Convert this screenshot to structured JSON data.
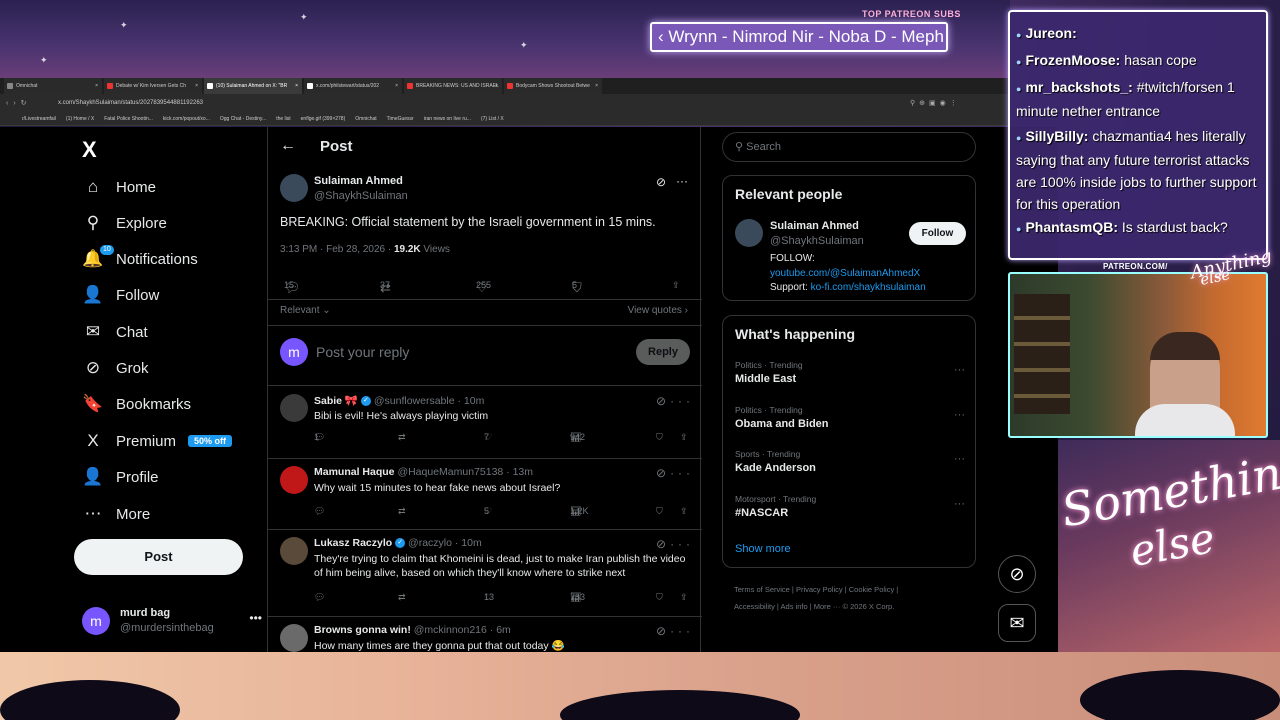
{
  "stream": {
    "ticker_heading": "TOP PATREON SUBS",
    "ticker_text": "‹ Wrynn - Nimrod Nir - Noba D - Meph",
    "patreon_url": "PATREON.COM/",
    "logo_text_1": "Something",
    "logo_text_2": "else",
    "small_logo_1": "Anything",
    "small_logo_2": "else",
    "chat": [
      {
        "user": "Jureon:",
        "text": ""
      },
      {
        "user": "FrozenMoose:",
        "text": "hasan cope"
      },
      {
        "user": "mr_backshots_:",
        "text": "#twitch/forsen 1 minute nether entrance"
      },
      {
        "user": "SillyBilly:",
        "text": "chazmantia4 hes literally saying that any future terrorist attacks are 100% inside jobs to further support for this operation"
      },
      {
        "user": "PhantasmQB:",
        "text": "Is stardust back?"
      }
    ]
  },
  "browser": {
    "tabs": [
      {
        "label": "Omnichat",
        "active": false,
        "color": "#888"
      },
      {
        "label": "Debate w/ Kim Iversen Gets Ch",
        "active": false,
        "color": "#e33"
      },
      {
        "label": "(10) Sulaiman Ahmed on X: \"BR",
        "active": true,
        "color": "#fff"
      },
      {
        "label": "x.com/philstewart/status/202",
        "active": false,
        "color": "#fff"
      },
      {
        "label": "BREAKING NEWS: US AND ISRAEL",
        "active": false,
        "color": "#e33"
      },
      {
        "label": "Bodycam Shows Shootout Betwe",
        "active": false,
        "color": "#e33"
      }
    ],
    "url": "x.com/ShaykhSulaiman/status/2027839544881192263",
    "bookmarks": [
      "r/Livestreamfail",
      "(1) Home / X",
      "Fatal Police Shootin...",
      "kick.com/popout/xo...",
      "Ogg Chat - Destiny...",
      "the list",
      "enflge.gif (399×278)",
      "Omnichat",
      "TimeGuessr",
      "iran news on live ru...",
      "(7) List / X"
    ]
  },
  "x": {
    "logo": "X",
    "nav": [
      {
        "label": "Home",
        "icon": "home-icon",
        "glyph": "⌂"
      },
      {
        "label": "Explore",
        "icon": "search-icon",
        "glyph": "⚲"
      },
      {
        "label": "Notifications",
        "icon": "bell-icon",
        "glyph": "🔔"
      },
      {
        "label": "Follow",
        "icon": "add-person-icon",
        "glyph": "👤"
      },
      {
        "label": "Chat",
        "icon": "mail-icon",
        "glyph": "✉"
      },
      {
        "label": "Grok",
        "icon": "grok-icon",
        "glyph": "⊘"
      },
      {
        "label": "Bookmarks",
        "icon": "bookmark-icon",
        "glyph": "🔖"
      },
      {
        "label": "Premium",
        "icon": "x-premium-icon",
        "glyph": "X"
      },
      {
        "label": "Profile",
        "icon": "person-icon",
        "glyph": "👤"
      },
      {
        "label": "More",
        "icon": "more-circle-icon",
        "glyph": "⋯"
      }
    ],
    "notif_badge": "10",
    "premium_badge": "50% off",
    "post_button": "Post",
    "account": {
      "name": "murd bag",
      "handle": "@murdersinthebag",
      "initial": "m"
    },
    "header_title": "Post",
    "main_post": {
      "name": "Sulaiman Ahmed",
      "handle": "@ShaykhSulaiman",
      "text": "BREAKING: Official statement by the Israeli government in 15 mins.",
      "time": "3:13 PM · Feb 28, 2026 · ",
      "views": "19.2K",
      "views_label": " Views",
      "replies": "15",
      "reposts": "37",
      "likes": "255",
      "bookmarks": "5"
    },
    "sort_label": "Relevant",
    "view_quotes": "View quotes ›",
    "reply_placeholder": "Post your reply",
    "reply_button": "Reply",
    "replies": [
      {
        "name": "Sabie 🎀",
        "handle": "@sunflowersable · 10m",
        "verified": true,
        "text": "Bibi is evil! He's always playing victim",
        "replies": "1",
        "reposts": "",
        "likes": "7",
        "views": "942",
        "avatar": "#3a3a3a"
      },
      {
        "name": "Mamunal Haque",
        "handle": "@HaqueMamun75138 · 13m",
        "verified": false,
        "text": "Why wait 15 minutes to hear fake news about Israel?",
        "replies": "",
        "reposts": "",
        "likes": "5",
        "views": "1.2K",
        "avatar": "#c01818"
      },
      {
        "name": "Lukasz Raczylo",
        "handle": "@raczylo · 10m",
        "verified": true,
        "text": "They're trying to claim that Khomeini is dead, just to make Iran publish the video of him being alive, based on which they'll know where to strike next",
        "replies": "",
        "reposts": "",
        "likes": "13",
        "views": "753",
        "avatar": "#5a4a3a"
      },
      {
        "name": "Browns gonna win!",
        "handle": "@mckinnon216 · 6m",
        "verified": false,
        "text": "How many times are they gonna put that out today 😂",
        "replies": "",
        "reposts": "",
        "likes": "",
        "views": "",
        "avatar": "#6a6a6a"
      }
    ],
    "search_placeholder": "Search",
    "relevant_title": "Relevant people",
    "relevant": {
      "name": "Sulaiman Ahmed",
      "handle": "@ShaykhSulaiman",
      "follow": "Follow",
      "bio1": "FOLLOW:",
      "bio2": "youtube.com/@SulaimanAhmedX",
      "bio3_label": "Support: ",
      "bio3": "ko-fi.com/shaykhsulaiman"
    },
    "happening_title": "What's happening",
    "trends": [
      {
        "cat": "Politics · Trending",
        "name": "Middle East"
      },
      {
        "cat": "Politics · Trending",
        "name": "Obama and Biden"
      },
      {
        "cat": "Sports · Trending",
        "name": "Kade Anderson"
      },
      {
        "cat": "Motorsport · Trending",
        "name": "#NASCAR"
      }
    ],
    "show_more": "Show more",
    "footer1": "Terms of Service  |  Privacy Policy  |  Cookie Policy  |",
    "footer2": "Accessibility  |  Ads info  |  More ···  © 2026 X Corp."
  }
}
